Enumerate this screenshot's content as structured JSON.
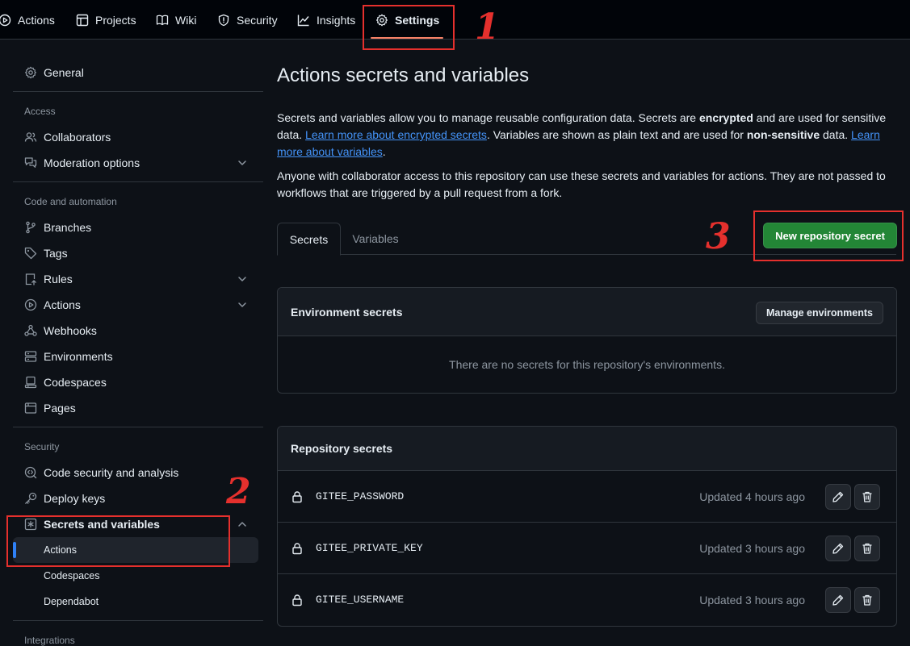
{
  "nav": {
    "items": [
      {
        "label": "Actions",
        "icon": "play-icon"
      },
      {
        "label": "Projects",
        "icon": "table-icon"
      },
      {
        "label": "Wiki",
        "icon": "book-icon"
      },
      {
        "label": "Security",
        "icon": "shield-icon"
      },
      {
        "label": "Insights",
        "icon": "graph-icon"
      },
      {
        "label": "Settings",
        "icon": "gear-icon",
        "active": true
      }
    ]
  },
  "sidebar": {
    "general": "General",
    "access_heading": "Access",
    "collaborators": "Collaborators",
    "moderation": "Moderation options",
    "code_heading": "Code and automation",
    "branches": "Branches",
    "tags": "Tags",
    "rules": "Rules",
    "actions": "Actions",
    "webhooks": "Webhooks",
    "environments": "Environments",
    "codespaces": "Codespaces",
    "pages": "Pages",
    "security_heading": "Security",
    "code_security": "Code security and analysis",
    "deploy_keys": "Deploy keys",
    "secrets_vars": "Secrets and variables",
    "sub_actions": "Actions",
    "sub_codespaces": "Codespaces",
    "sub_dependabot": "Dependabot",
    "integrations_heading": "Integrations"
  },
  "main": {
    "title": "Actions secrets and variables",
    "para1": {
      "t1": "Secrets and variables allow you to manage reusable configuration data. Secrets are ",
      "b1": "encrypted",
      "t2": " and are used for sensitive data. ",
      "link1": "Learn more about encrypted secrets",
      "t3": ". Variables are shown as plain text and are used for ",
      "b2": "non-sensitive",
      "t4": " data. ",
      "link2": "Learn more about variables",
      "t5": "."
    },
    "para2": "Anyone with collaborator access to this repository can use these secrets and variables for actions. They are not passed to workflows that are triggered by a pull request from a fork.",
    "tabs": [
      "Secrets",
      "Variables"
    ],
    "new_secret_button": "New repository secret",
    "env_secrets": {
      "title": "Environment secrets",
      "manage_button": "Manage environments",
      "empty": "There are no secrets for this repository's environments."
    },
    "repo_secrets": {
      "title": "Repository secrets",
      "rows": [
        {
          "name": "GITEE_PASSWORD",
          "updated": "Updated 4 hours ago"
        },
        {
          "name": "GITEE_PRIVATE_KEY",
          "updated": "Updated 3 hours ago"
        },
        {
          "name": "GITEE_USERNAME",
          "updated": "Updated 3 hours ago"
        }
      ]
    }
  },
  "annotations": {
    "n1": "1",
    "n2": "2",
    "n3": "3",
    "color": "#e5302d"
  },
  "colors": {
    "background": "#0d1117",
    "nav_bg": "#010409",
    "border": "#30363d",
    "green_button": "#238636",
    "link": "#4493f8",
    "active_marker": "#2f81f7",
    "nav_underline": "#f78166"
  }
}
